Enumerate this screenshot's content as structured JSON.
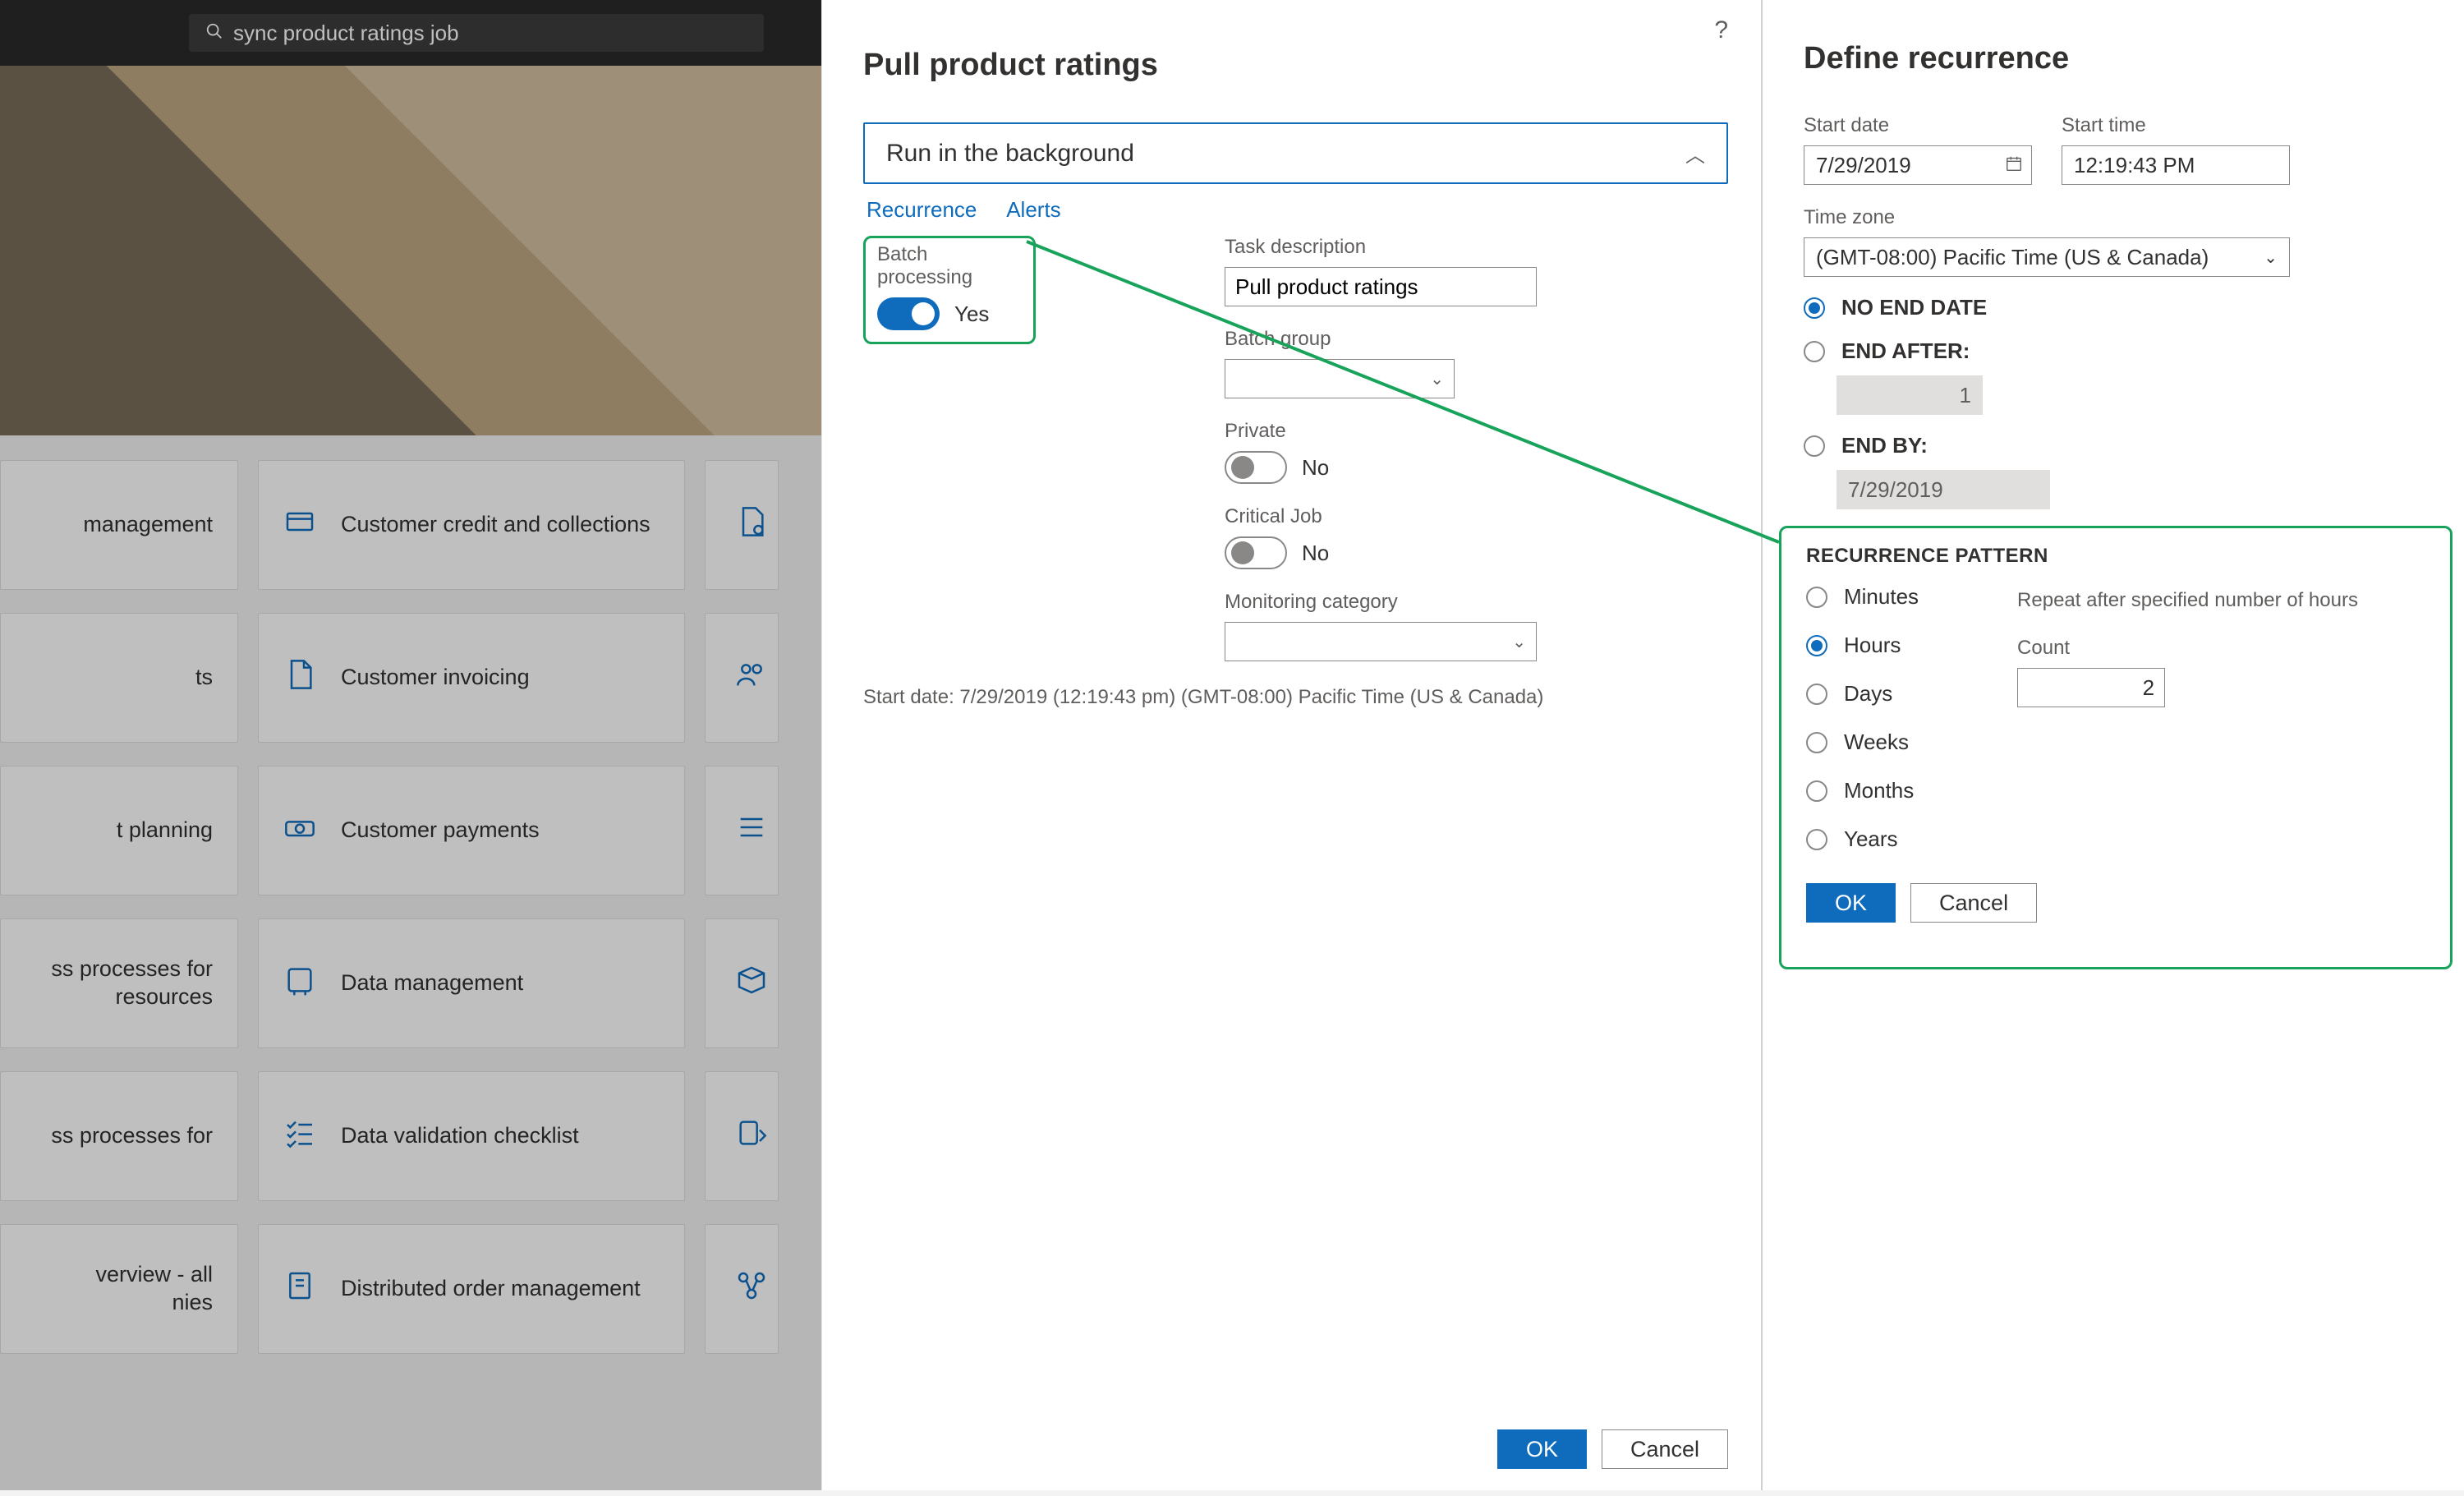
{
  "search": {
    "value": "sync product ratings job"
  },
  "tiles": {
    "row1": {
      "left": "management",
      "mid": "Customer credit and collections"
    },
    "row2": {
      "left": "ts",
      "mid": "Customer invoicing"
    },
    "row3": {
      "left": "t planning",
      "mid": "Customer payments"
    },
    "row4": {
      "left": "ss processes for\nresources",
      "mid": "Data management"
    },
    "row5": {
      "left": "ss processes for",
      "mid": "Data validation checklist"
    },
    "row6": {
      "left": "verview - all\nnies",
      "mid": "Distributed order management"
    }
  },
  "center": {
    "title": "Pull product ratings",
    "expander_title": "Run in the background",
    "links": {
      "recurrence": "Recurrence",
      "alerts": "Alerts"
    },
    "batch_label": "Batch processing",
    "batch_value": "Yes",
    "task_desc_label": "Task description",
    "task_desc_value": "Pull product ratings",
    "batch_group_label": "Batch group",
    "private_label": "Private",
    "private_value": "No",
    "critical_label": "Critical Job",
    "critical_value": "No",
    "monitoring_label": "Monitoring category",
    "footnote": "Start date: 7/29/2019 (12:19:43 pm) (GMT-08:00) Pacific Time (US & Canada)",
    "ok": "OK",
    "cancel": "Cancel"
  },
  "recurrence": {
    "title": "Define recurrence",
    "start_date_label": "Start date",
    "start_date": "7/29/2019",
    "start_time_label": "Start time",
    "start_time": "12:19:43 PM",
    "tz_label": "Time zone",
    "tz_value": "(GMT-08:00) Pacific Time (US & Canada)",
    "no_end_label": "NO END DATE",
    "end_after_label": "END AFTER:",
    "end_after_value": "1",
    "end_by_label": "END BY:",
    "end_by_value": "7/29/2019",
    "pattern_heading": "RECURRENCE PATTERN",
    "opts": {
      "minutes": "Minutes",
      "hours": "Hours",
      "days": "Days",
      "weeks": "Weeks",
      "months": "Months",
      "years": "Years"
    },
    "repeat_note": "Repeat after specified number of hours",
    "count_label": "Count",
    "count_value": "2",
    "ok": "OK",
    "cancel": "Cancel"
  }
}
